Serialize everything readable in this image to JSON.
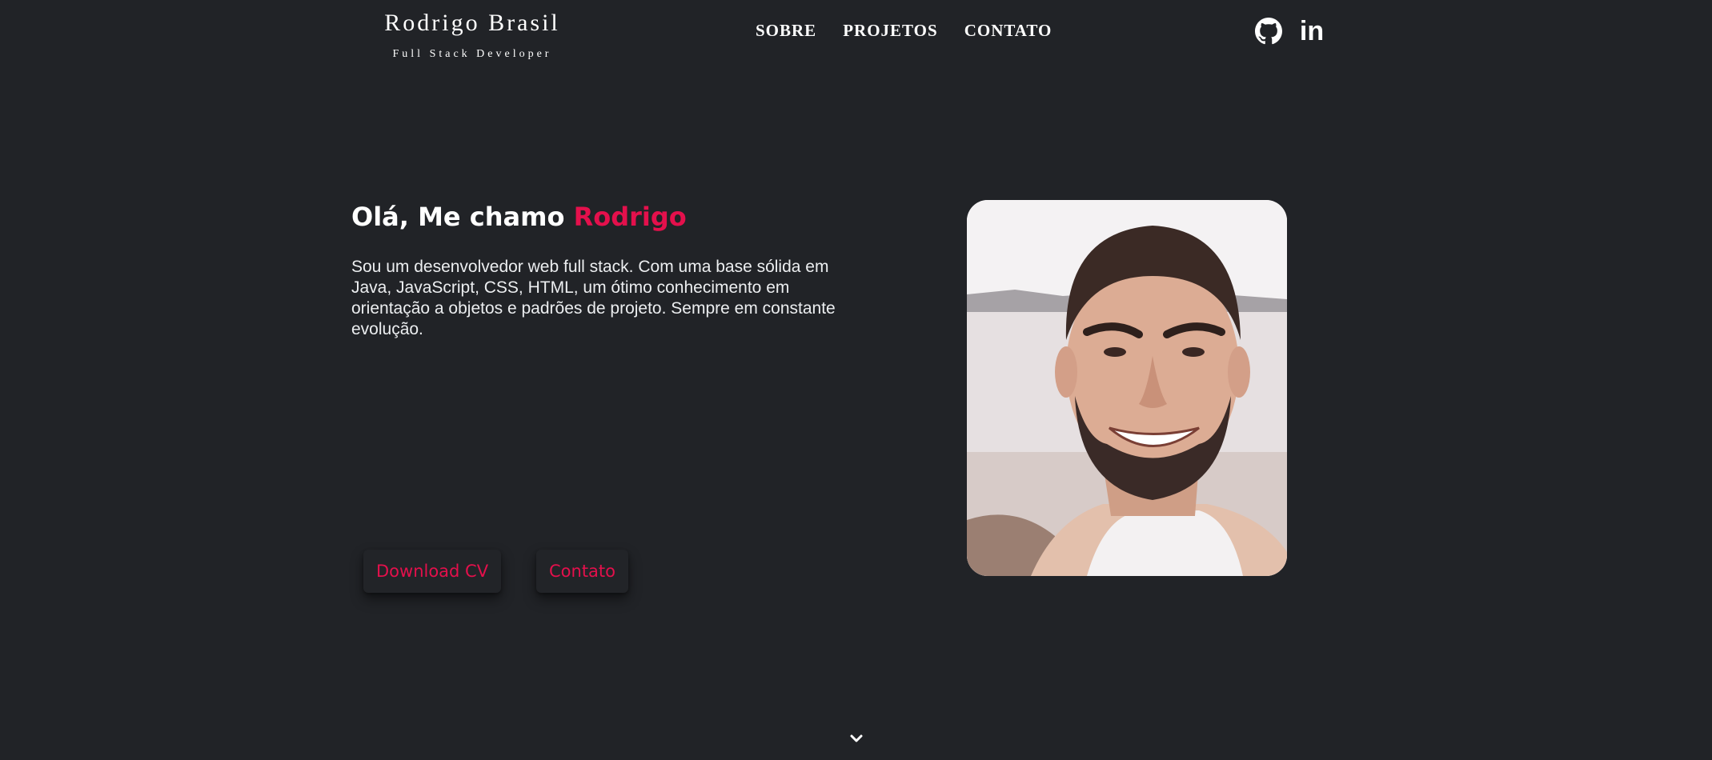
{
  "header": {
    "brand_name": "Rodrigo Brasil",
    "brand_subtitle": "Full Stack Developer",
    "nav": [
      {
        "label": "SOBRE"
      },
      {
        "label": "PROJETOS"
      },
      {
        "label": "CONTATO"
      }
    ],
    "social": [
      {
        "icon": "github-icon"
      },
      {
        "icon": "linkedin-icon",
        "glyph": "in"
      }
    ]
  },
  "hero": {
    "greeting": "Olá, Me chamo ",
    "name": "Rodrigo",
    "description": "Sou um desenvolvedor web full stack. Com uma base sólida em Java, JavaScript, CSS, HTML, um ótimo conhecimento em orientação a objetos e padrões de projeto. Sempre em constante evolução.",
    "buttons": {
      "download_cv": "Download CV",
      "contato": "Contato"
    }
  },
  "colors": {
    "background": "#212327",
    "accent": "#e4104c",
    "text": "#ffffff"
  },
  "scroll_icon": "chevron-down-icon"
}
